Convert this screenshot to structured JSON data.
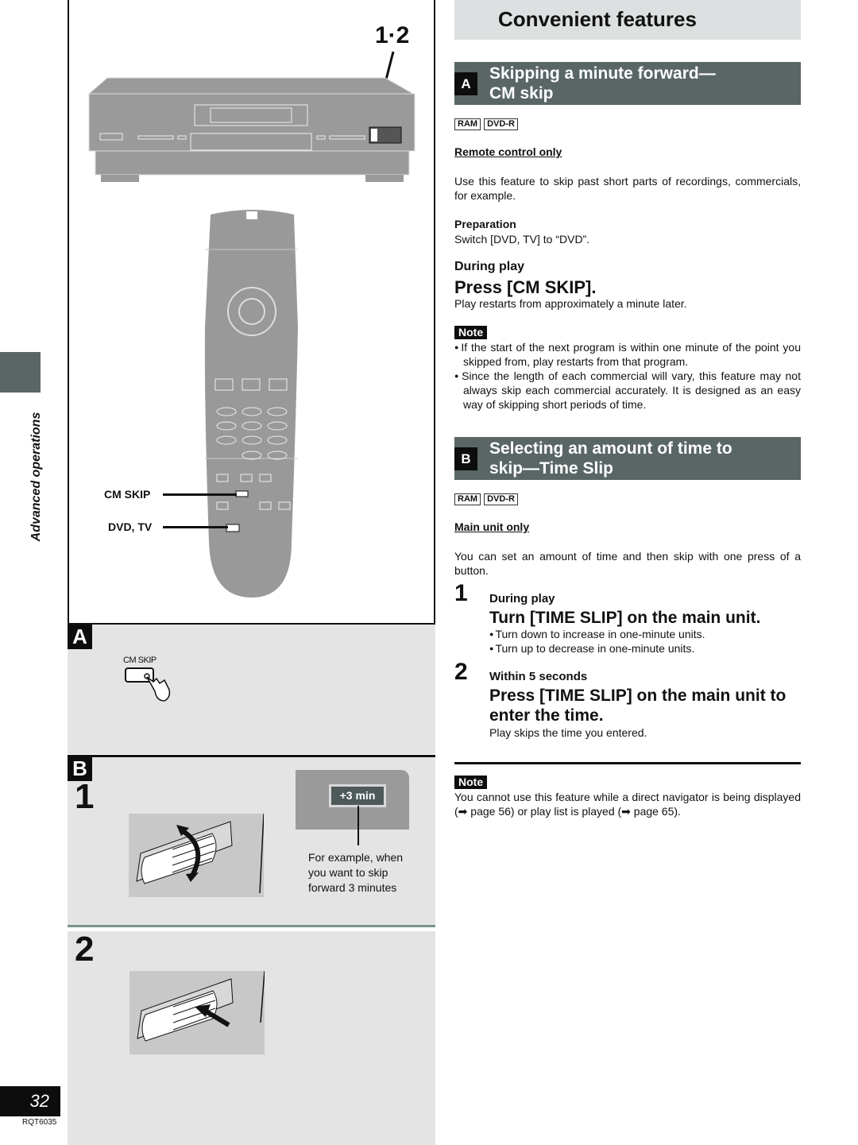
{
  "left": {
    "side_label": "Advanced operations",
    "page_number": "32",
    "doc_code": "RQT6035",
    "figure": {
      "step_ref": "1·2",
      "callouts": [
        "CM SKIP",
        "DVD, TV"
      ]
    },
    "panel_a": {
      "letter": "A",
      "button_label": "CM SKIP"
    },
    "panel_b": {
      "letter": "B",
      "step1": "1",
      "display_value": "+3 min",
      "example_text": "For example, when you want to skip forward 3 minutes",
      "step2": "2"
    }
  },
  "header": {
    "title": "Convenient features"
  },
  "section_a": {
    "letter": "A",
    "title_line1": "Skipping a minute forward—",
    "title_line2": "CM skip",
    "tags": [
      "RAM",
      "DVD-R"
    ],
    "scope": "Remote control only",
    "intro": "Use this feature to skip past short parts of recordings, commercials, for example.",
    "preparation_label": "Preparation",
    "preparation_text": "Switch [DVD, TV] to “DVD”.",
    "condition": "During play",
    "action": "Press [CM SKIP].",
    "result": "Play restarts from approximately a minute later.",
    "note_label": "Note",
    "notes": [
      "If the start of the next program is within one minute of the point you skipped from, play restarts from that program.",
      "Since the length of each commercial will vary, this feature may not always skip each commercial accurately. It is designed as an easy way of skipping short periods of time."
    ]
  },
  "section_b": {
    "letter": "B",
    "title_line1": "Selecting an amount of time to",
    "title_line2": "skip—Time Slip",
    "tags": [
      "RAM",
      "DVD-R"
    ],
    "scope": "Main unit only",
    "intro": "You can set an amount of time and then skip with one press of a button.",
    "steps": [
      {
        "num": "1",
        "condition": "During play",
        "action": "Turn [TIME SLIP] on the main unit.",
        "bullets": [
          "Turn down to increase in one-minute units.",
          "Turn up to decrease in one-minute units."
        ]
      },
      {
        "num": "2",
        "condition": "Within 5 seconds",
        "action": "Press [TIME SLIP] on the main unit to enter the time.",
        "result": "Play skips the time you entered."
      }
    ],
    "note_label": "Note",
    "note_text": "You cannot use this feature while a direct navigator is being displayed (➡ page 56) or play list is played (➡ page 65)."
  }
}
